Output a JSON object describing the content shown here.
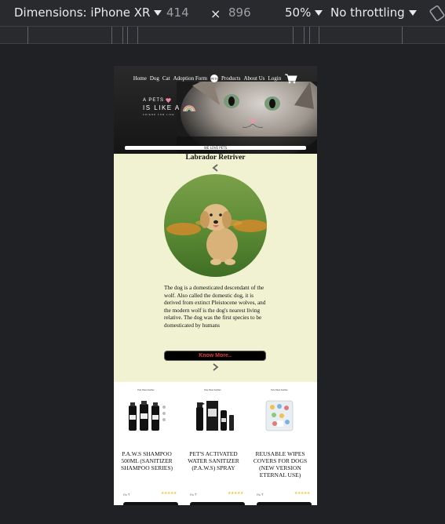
{
  "devtools": {
    "device": "Dimensions: iPhone XR",
    "width": "414",
    "times": "×",
    "height": "896",
    "zoom": "50%",
    "throttle": "No throttling"
  },
  "nav": {
    "items": [
      "Home",
      "Dog",
      "Cat",
      "Adoption Form"
    ],
    "logo_text": "PETS",
    "items_right": [
      "Products",
      "About Us",
      "Login"
    ]
  },
  "hero": {
    "line1": "A PETS",
    "line2": "IS LIKE A",
    "line3": "FRIEND FOR LIFE",
    "banner": "WE LOVE PETS"
  },
  "carousel": {
    "title": "Labrador Retriver",
    "description": "The dog is a domesticated descendant of the wolf. Also called the domestic dog, it is derived from extinct Pleistocene wolves, and the modern wolf is the dog's nearest living relative. The dog was the first species to be domesticated by humans",
    "button": "Know More.."
  },
  "products": [
    {
      "brand": "Pets Paws Fashion",
      "name": "P.A.W.S SHAMPOO 500ML (SANITIZER SHAMPOO SERIES)",
      "price": "Rs ₹",
      "stars": "★★★★★"
    },
    {
      "brand": "Pets Paws Fashion",
      "name": "PET'S ACTIVATED WATER SANITIZER (P.A.W.S) SPRAY",
      "price": "Rs ₹",
      "stars": "★★★★★"
    },
    {
      "brand": "Pets Paws Fashion",
      "name": "REUSABLE WIPES COVERS FOR DOGS (NEW VERSION ETERNAL USE)",
      "price": "Rs ₹",
      "stars": "★★★★★"
    }
  ],
  "colors": {
    "carousel_bg": "#f0f2d2",
    "button_text": "#e23b3b",
    "devtools_bg": "#292a2d"
  }
}
